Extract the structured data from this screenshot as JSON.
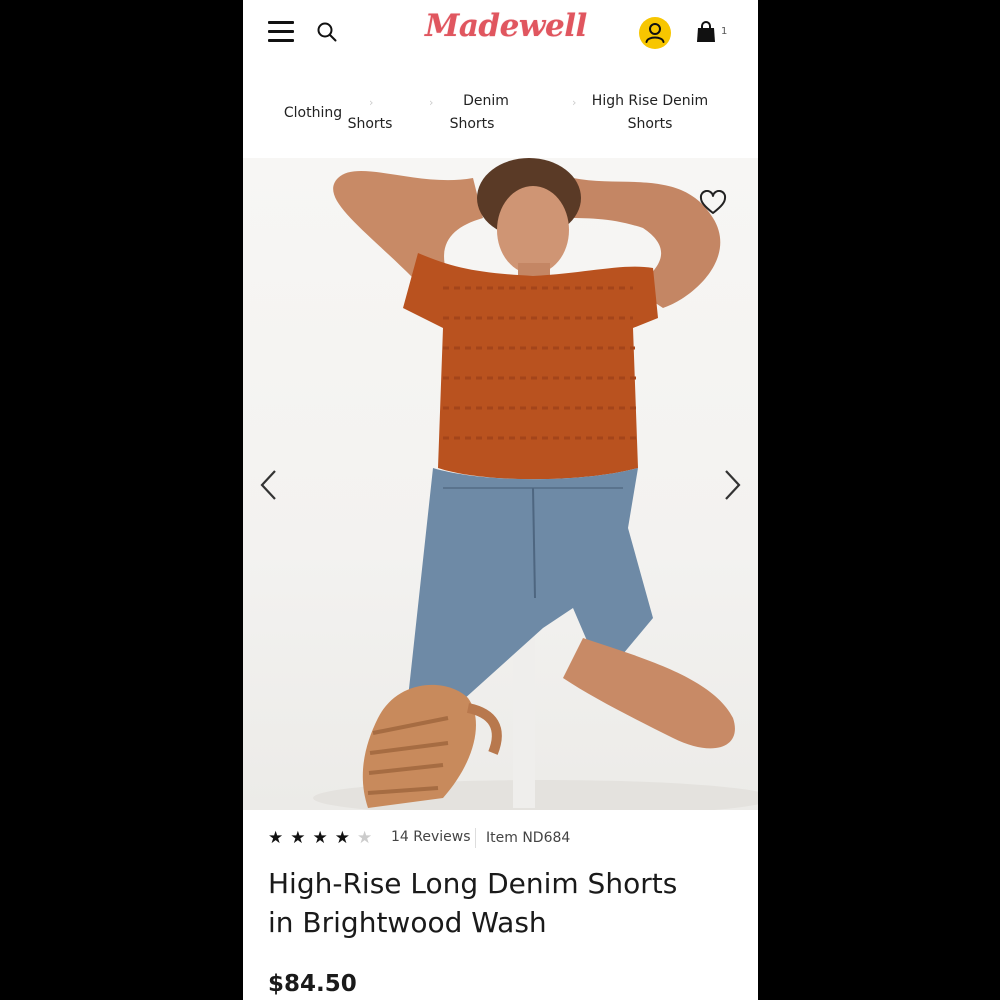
{
  "header": {
    "logo": "Madewell",
    "bag_count": "1"
  },
  "breadcrumbs": [
    {
      "line1": "",
      "line2": "Clothing"
    },
    {
      "line1": "",
      "line2": "Shorts"
    },
    {
      "line1": "Denim",
      "line2": "Shorts"
    },
    {
      "line1": "High Rise Denim",
      "line2": "Shorts"
    }
  ],
  "product": {
    "rating": 4,
    "rating_max": 5,
    "reviews_label": "14 Reviews",
    "item_number": "Item ND684",
    "title_line1": "High-Rise Long Denim Shorts",
    "title_line2": "in Brightwood Wash",
    "price": "$84.50"
  },
  "colors": {
    "logo": "#e0565f",
    "account": "#f7c600",
    "star_filled": "#111111",
    "star_empty": "#cccccc"
  },
  "icons": [
    "hamburger-icon",
    "search-icon",
    "account-icon",
    "bag-icon",
    "heart-icon",
    "chevron-left-icon",
    "chevron-right-icon",
    "star-icon"
  ]
}
